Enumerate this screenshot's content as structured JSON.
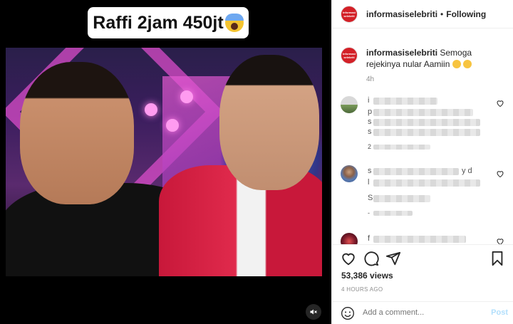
{
  "media": {
    "caption_text": "Raffi 2jam 450jt",
    "caption_emoji": "scream-emoji",
    "mute_icon": "speaker-muted-icon"
  },
  "post": {
    "username": "informasiselebriti",
    "separator": "•",
    "follow_status": "Following",
    "avatar_text": "informasi selebriti",
    "avatar_color": "#d32027"
  },
  "caption": {
    "username": "informasiselebriti",
    "text": "Semoga rejekinya nular Aamiin",
    "time": "4h"
  },
  "comments": [
    {
      "initial": "i",
      "avatar": "comment-avatar-1",
      "lines": [
        "p",
        "s",
        "s"
      ],
      "blurred": true
    },
    {
      "initial": "s",
      "avatar": "comment-avatar-2",
      "trailing": "y d",
      "lines": [
        "l",
        "S"
      ],
      "blurred": true
    },
    {
      "initial": "f",
      "avatar": "comment-avatar-3",
      "blurred": true
    }
  ],
  "comment_meta": [
    "2",
    "-"
  ],
  "actions": {
    "like_icon": "heart-icon",
    "comment_icon": "comment-bubble-icon",
    "share_icon": "paper-plane-icon",
    "save_icon": "bookmark-icon"
  },
  "views": "53,386 views",
  "timestamp": "4 HOURS AGO",
  "add_comment": {
    "placeholder": "Add a comment...",
    "post_label": "Post",
    "emoji_icon": "smiley-icon"
  },
  "colors": {
    "accent_disabled": "#b2dffc",
    "muted_text": "#8e8e8e",
    "border": "#efefef"
  }
}
